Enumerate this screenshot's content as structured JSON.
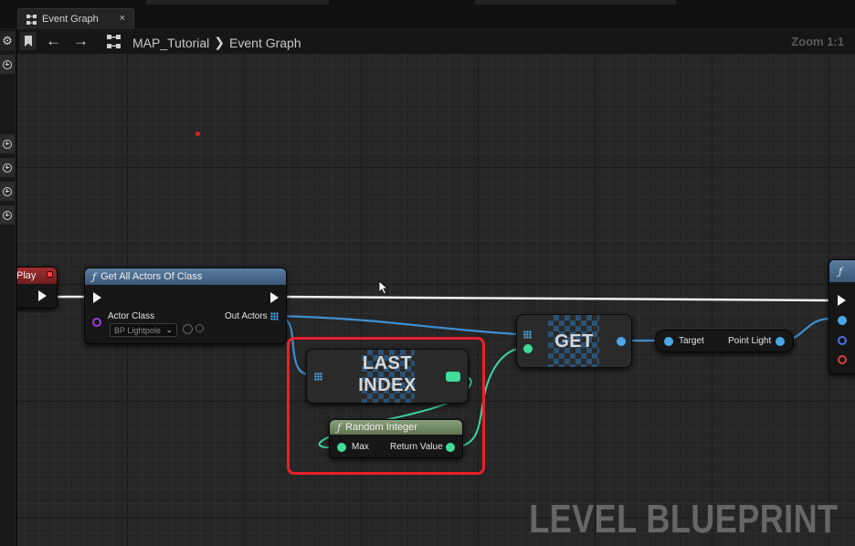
{
  "tab": {
    "label": "Event Graph",
    "close": "×"
  },
  "breadcrumb": {
    "back": "←",
    "forward": "→",
    "level": "MAP_Tutorial",
    "separator": "❯",
    "graph": "Event Graph",
    "zoom": "Zoom 1:1"
  },
  "nodes": {
    "begin_play": {
      "title": "Play"
    },
    "get_all_actors": {
      "title": "Get All Actors Of Class",
      "fx": "ƒ",
      "actor_class_label": "Actor Class",
      "actor_class_value": "BP Lightpole",
      "out_actors_label": "Out Actors"
    },
    "last_index": {
      "line1": "LAST",
      "line2": "INDEX"
    },
    "get": {
      "title": "GET"
    },
    "random_integer": {
      "title": "Random Integer",
      "fx": "ƒ",
      "max_label": "Max",
      "return_label": "Return Value"
    },
    "point_light": {
      "target_label": "Target",
      "output_label": "Point Light"
    },
    "right_node": {
      "fx": "ƒ"
    }
  },
  "watermark": "LEVEL BLUEPRINT",
  "colors": {
    "exec": "#f2f2f2",
    "object_pin": "#4aa8e8",
    "int_pin": "#3fdc9a",
    "class_pin": "#9a3fd8",
    "highlight": "#e8202a"
  }
}
